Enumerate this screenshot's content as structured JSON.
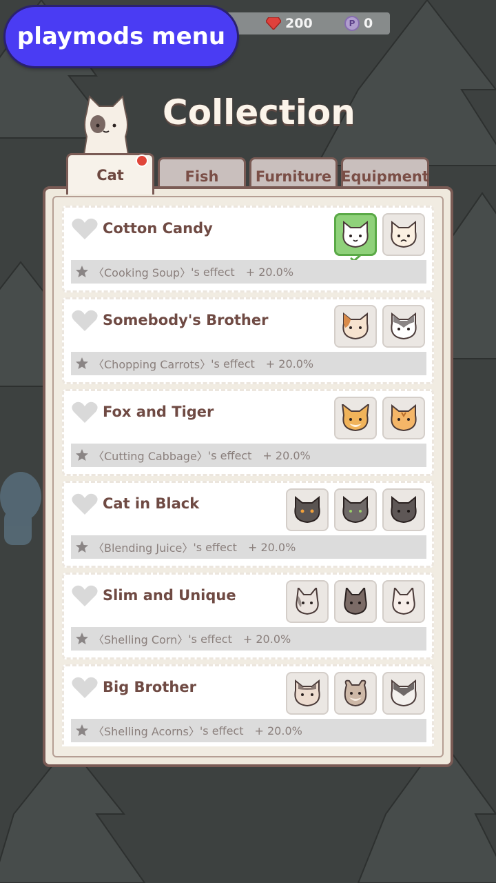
{
  "header": {
    "mod_button_label": "playmods menu",
    "gems": "200",
    "points": "0",
    "points_icon_letter": "P"
  },
  "title": "Collection",
  "tabs": [
    {
      "label": "Cat",
      "active": true,
      "has_notification": true
    },
    {
      "label": "Fish",
      "active": false
    },
    {
      "label": "Furniture",
      "active": false
    },
    {
      "label": "Equipment",
      "active": false
    }
  ],
  "cards": [
    {
      "name": "Cotton Candy",
      "effect_name": "〈Cooking Soup〉",
      "effect_suffix": "'s effect",
      "bonus": "+ 20.0%",
      "cats": [
        {
          "icon": "white-cat-face-icon",
          "owned": true,
          "color": "#ffffff"
        },
        {
          "icon": "cream-cat-face-icon",
          "owned": false,
          "color": "#fbf0e2"
        }
      ]
    },
    {
      "name": "Somebody's Brother",
      "effect_name": "〈Chopping Carrots〉",
      "effect_suffix": "'s effect",
      "bonus": "+ 20.0%",
      "cats": [
        {
          "icon": "calico-cat-face-icon",
          "owned": false,
          "color": "#f6e3cf"
        },
        {
          "icon": "gray-white-cat-face-icon",
          "owned": false,
          "color": "#ffffff"
        }
      ]
    },
    {
      "name": "Fox and Tiger",
      "effect_name": "〈Cutting Cabbage〉",
      "effect_suffix": "'s effect",
      "bonus": "+ 20.0%",
      "cats": [
        {
          "icon": "fox-cat-face-icon",
          "owned": false,
          "color": "#f0b35a"
        },
        {
          "icon": "tiger-cat-face-icon",
          "owned": false,
          "color": "#f4b668"
        }
      ]
    },
    {
      "name": "Cat in Black",
      "effect_name": "〈Blending Juice〉",
      "effect_suffix": "'s effect",
      "bonus": "+ 20.0%",
      "cats": [
        {
          "icon": "black-cat-face-icon",
          "owned": false,
          "color": "#5a5452"
        },
        {
          "icon": "dark-gray-cat-face-icon",
          "owned": false,
          "color": "#6f6968"
        },
        {
          "icon": "charcoal-cat-face-icon",
          "owned": false,
          "color": "#5e5756"
        }
      ]
    },
    {
      "name": "Slim and Unique",
      "effect_name": "〈Shelling Corn〉",
      "effect_suffix": "'s effect",
      "bonus": "+ 20.0%",
      "cats": [
        {
          "icon": "patched-cat-face-icon",
          "owned": false,
          "color": "#ece4df"
        },
        {
          "icon": "brown-cat-face-icon",
          "owned": false,
          "color": "#7b6b66"
        },
        {
          "icon": "pale-cat-face-icon",
          "owned": false,
          "color": "#f7eee9"
        }
      ]
    },
    {
      "name": "Big Brother",
      "effect_name": "〈Shelling Acorns〉",
      "effect_suffix": "'s effect",
      "bonus": "+ 20.0%",
      "cats": [
        {
          "icon": "tabby-cat-face-icon",
          "owned": false,
          "color": "#eddcd0"
        },
        {
          "icon": "mole-cat-face-icon",
          "owned": false,
          "color": "#cdb8a7"
        },
        {
          "icon": "masked-cat-face-icon",
          "owned": false,
          "color": "#f4f1ee"
        }
      ]
    }
  ]
}
